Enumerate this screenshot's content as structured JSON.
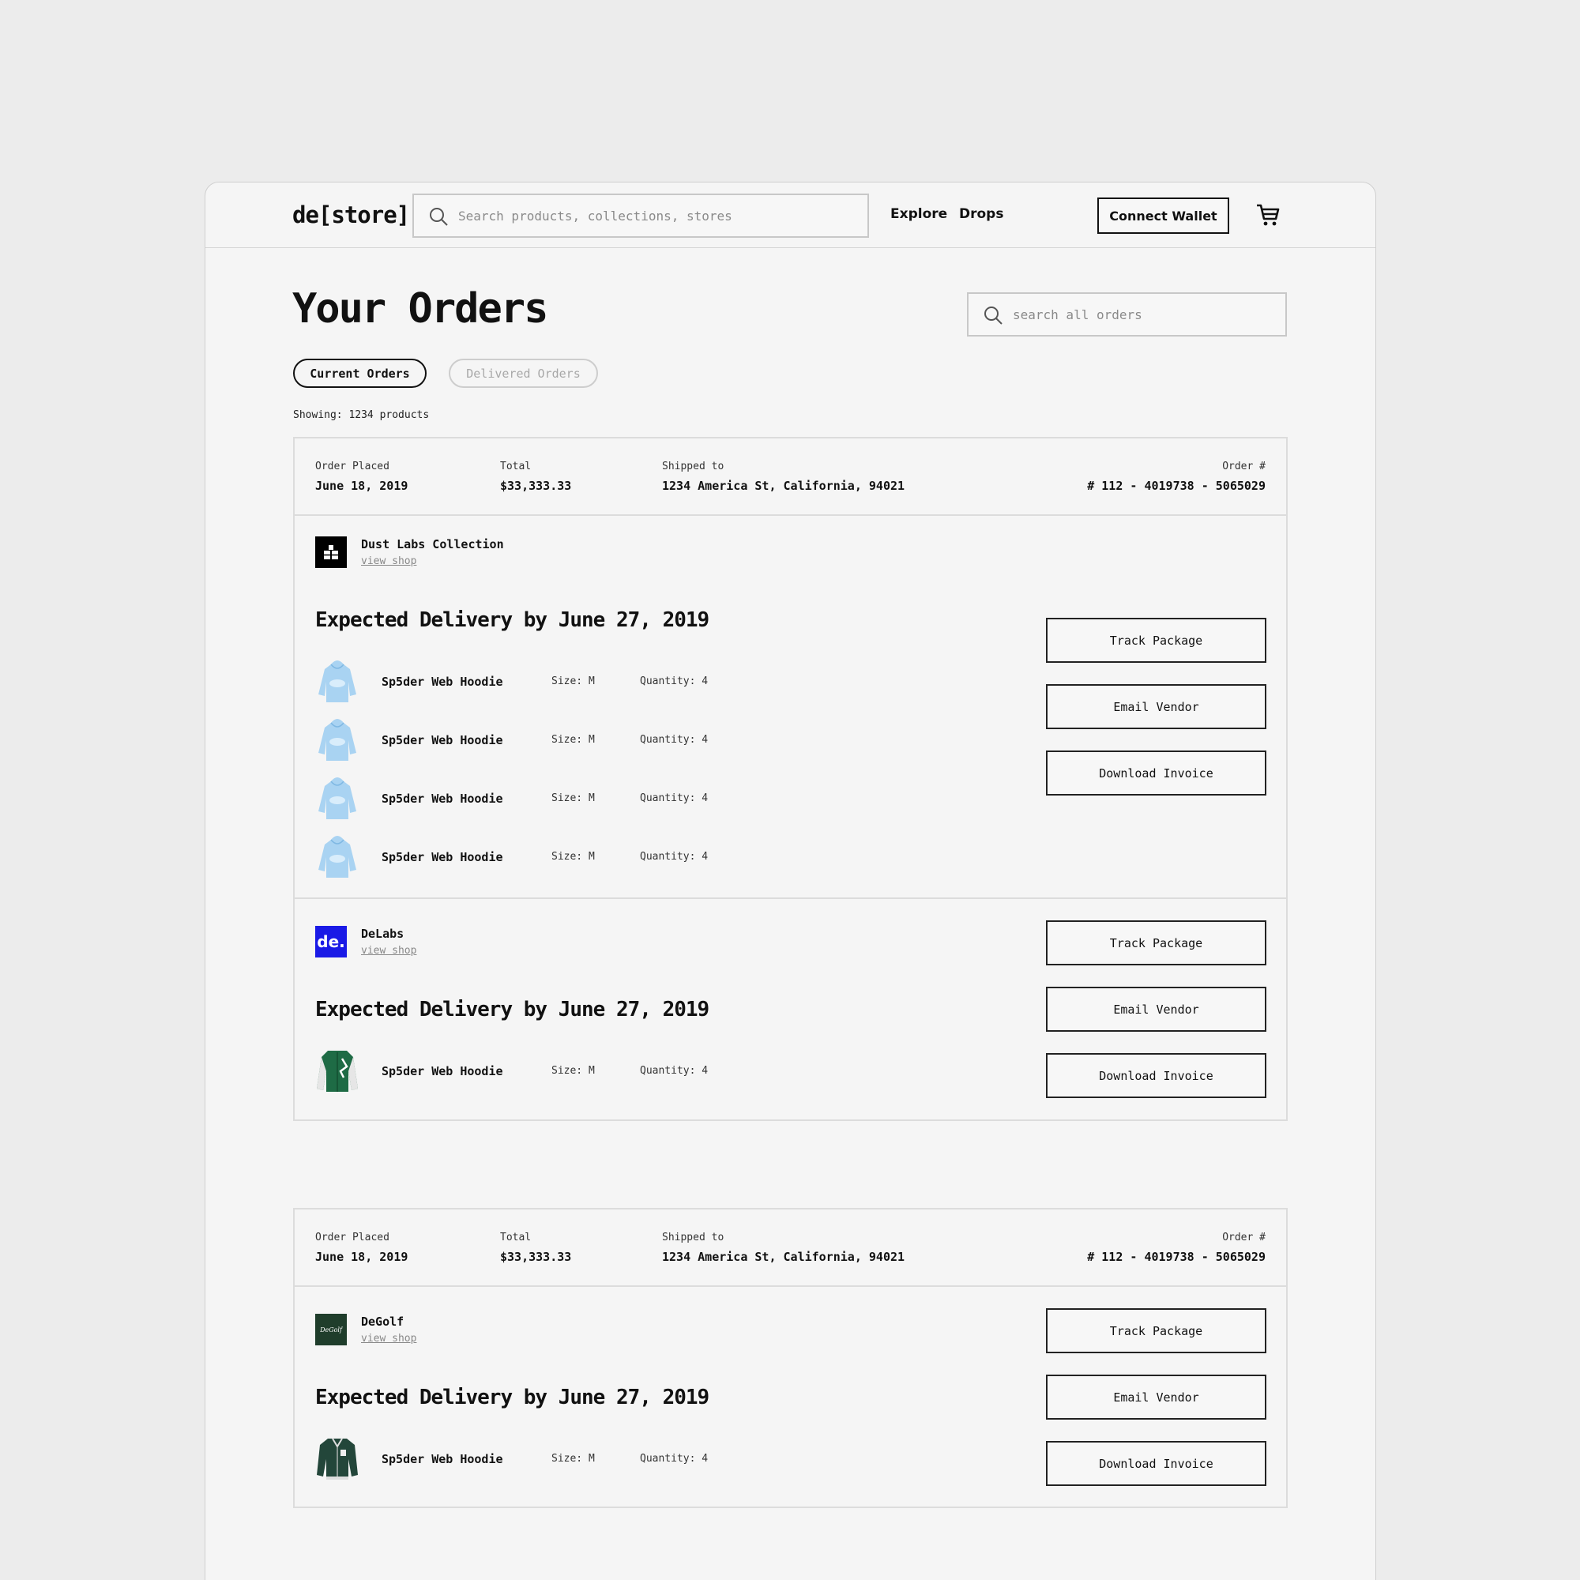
{
  "app": {
    "logo": "de[store]",
    "search_placeholder": "Search products, collections, stores",
    "nav": [
      "Explore",
      "Drops"
    ],
    "connect_wallet": "Connect Wallet"
  },
  "page": {
    "title": "Your Orders",
    "order_search_placeholder": "search all orders",
    "tabs": [
      "Current Orders",
      "Delivered Orders"
    ],
    "showing": "Showing: 1234 products"
  },
  "labels": {
    "order_placed": "Order Placed",
    "total": "Total",
    "shipped_to": "Shipped to",
    "order_number": "Order #",
    "view_shop": "view shop",
    "track": "Track Package",
    "email": "Email Vendor",
    "invoice": "Download Invoice"
  },
  "orders": [
    {
      "placed": "June 18, 2019",
      "total": "$33,333.33",
      "shipped_to": "1234 America St, California, 94021",
      "order_no": "# 112 - 4019738 - 5065029",
      "vendors": [
        {
          "name": "Dust Labs Collection",
          "delivery": "Expected Delivery by June 27, 2019",
          "items": [
            {
              "name": "Sp5der Web Hoodie",
              "size": "Size: M",
              "qty": "Quantity: 4"
            },
            {
              "name": "Sp5der Web Hoodie",
              "size": "Size: M",
              "qty": "Quantity: 4"
            },
            {
              "name": "Sp5der Web Hoodie",
              "size": "Size: M",
              "qty": "Quantity: 4"
            },
            {
              "name": "Sp5der Web Hoodie",
              "size": "Size: M",
              "qty": "Quantity: 4"
            }
          ]
        },
        {
          "name": "DeLabs",
          "logo_text": "de.",
          "delivery": "Expected Delivery by June 27, 2019",
          "items": [
            {
              "name": "Sp5der Web Hoodie",
              "size": "Size: M",
              "qty": "Quantity: 4"
            }
          ]
        }
      ]
    },
    {
      "placed": "June 18, 2019",
      "total": "$33,333.33",
      "shipped_to": "1234 America St, California, 94021",
      "order_no": "# 112 - 4019738 - 5065029",
      "vendors": [
        {
          "name": "DeGolf",
          "logo_text": "DeGolf",
          "delivery": "Expected Delivery by June 27, 2019",
          "items": [
            {
              "name": "Sp5der Web Hoodie",
              "size": "Size: M",
              "qty": "Quantity: 4"
            }
          ]
        }
      ]
    }
  ],
  "colors": {
    "background": "#ececec",
    "panel": "#f5f5f5",
    "delabs_blue": "#1a1ae6",
    "degolf_green": "#1f3d2b",
    "hoodie_blue": "#a9d3f2",
    "jacket_green": "#1e6b45"
  },
  "icons": [
    "search-icon",
    "cart-icon",
    "dust-labs-logo",
    "hoodie-thumbnail",
    "varsity-jacket-thumbnail"
  ]
}
